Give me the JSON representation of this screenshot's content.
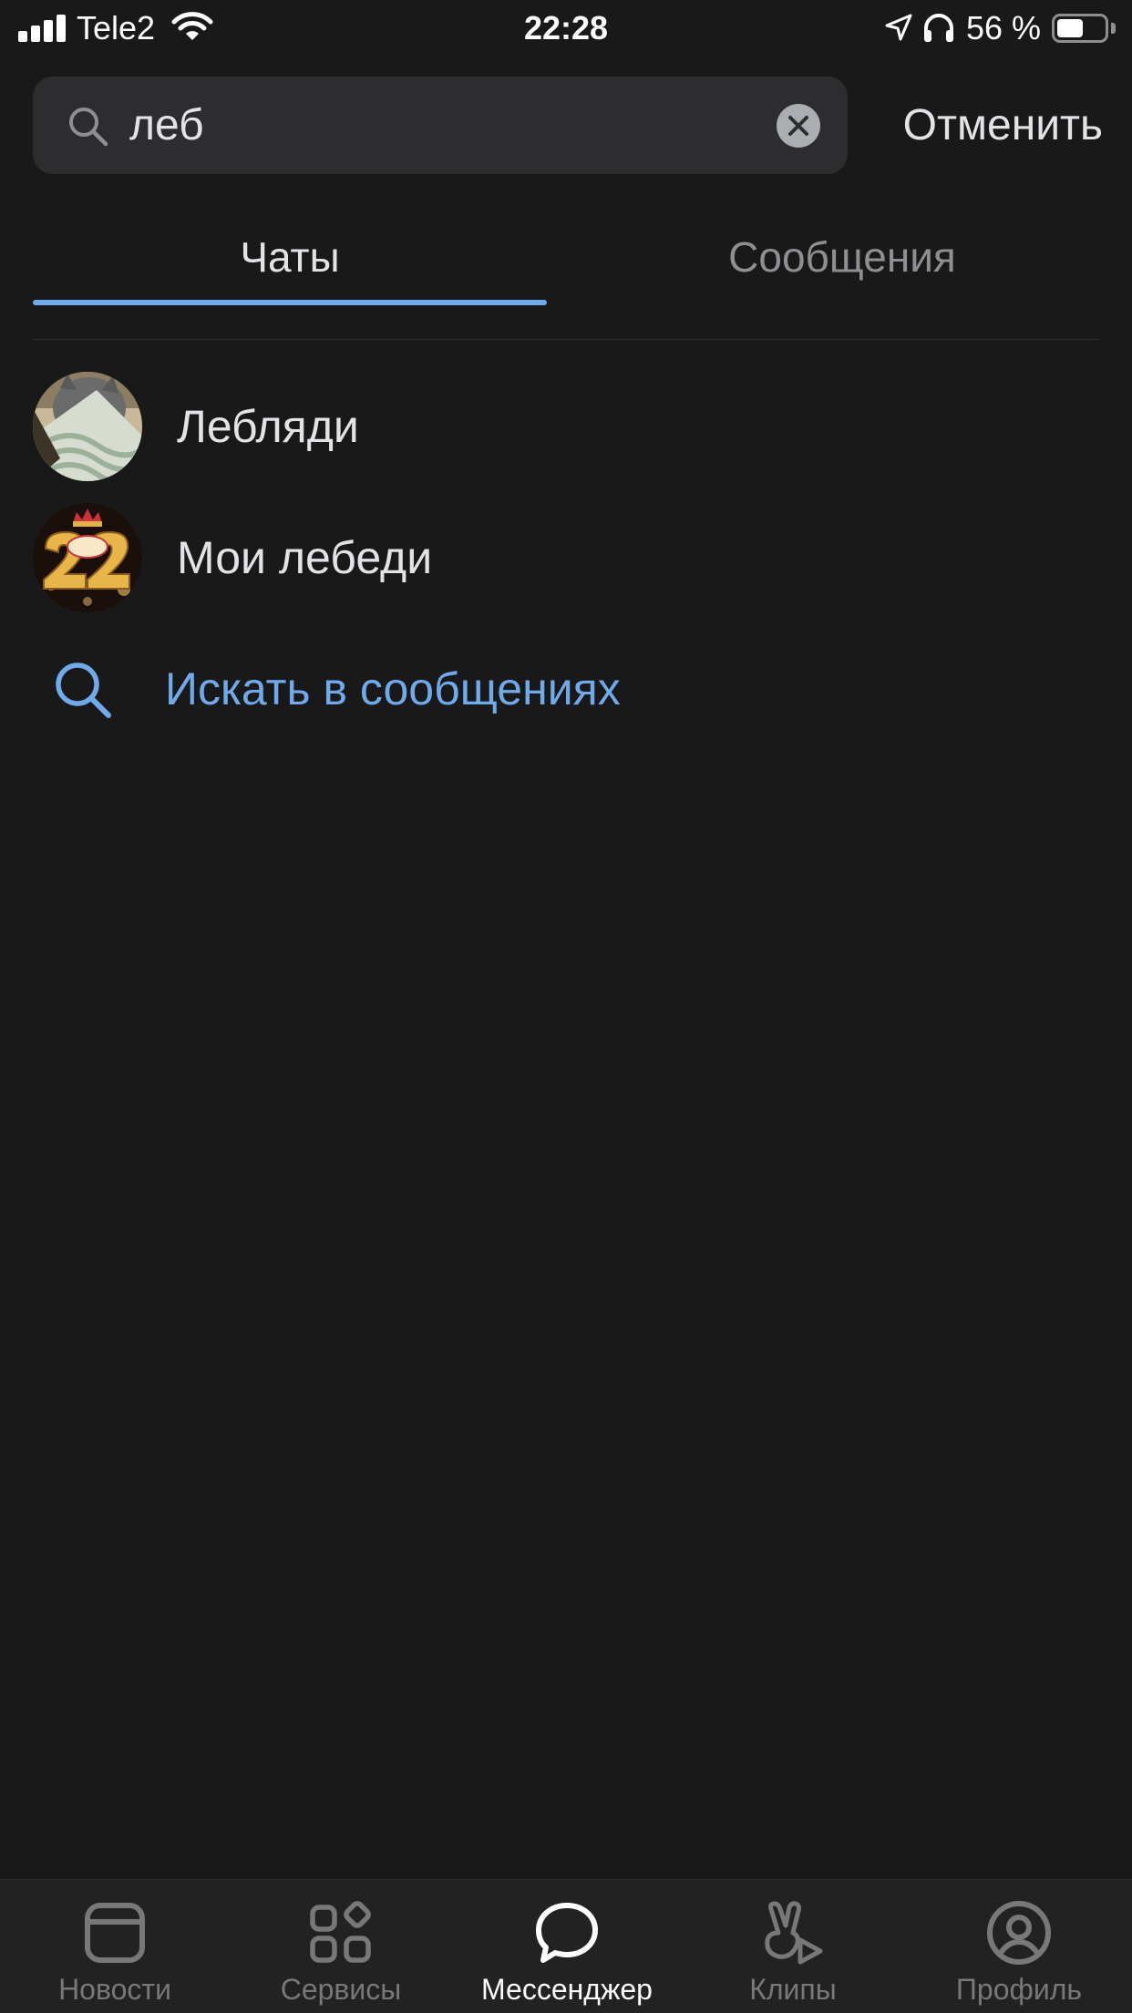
{
  "status_bar": {
    "carrier": "Tele2",
    "time": "22:28",
    "battery_text": "56 %",
    "battery_level": 0.56
  },
  "search": {
    "query": "леб",
    "cancel_label": "Отменить"
  },
  "tabs": [
    {
      "label": "Чаты",
      "active": true
    },
    {
      "label": "Сообщения",
      "active": false
    }
  ],
  "chats": [
    {
      "name": "Лебляди",
      "avatar": "cat-photo"
    },
    {
      "name": "Мои лебеди",
      "avatar": "number-22-birthday-image"
    }
  ],
  "search_messages": {
    "label": "Искать в сообщениях"
  },
  "tab_bar": {
    "items": [
      {
        "label": "Новости",
        "icon": "news-icon",
        "active": false
      },
      {
        "label": "Сервисы",
        "icon": "services-icon",
        "active": false
      },
      {
        "label": "Мессенджер",
        "icon": "messenger-icon",
        "active": true
      },
      {
        "label": "Клипы",
        "icon": "clips-icon",
        "active": false
      },
      {
        "label": "Профиль",
        "icon": "profile-icon",
        "active": false
      }
    ]
  },
  "colors": {
    "background": "#191919",
    "accent": "#71aaeb",
    "text_primary": "#e1e3e6",
    "text_secondary": "#8d8f93",
    "search_field": "#2d2d2f",
    "tab_bar": "#222222"
  }
}
